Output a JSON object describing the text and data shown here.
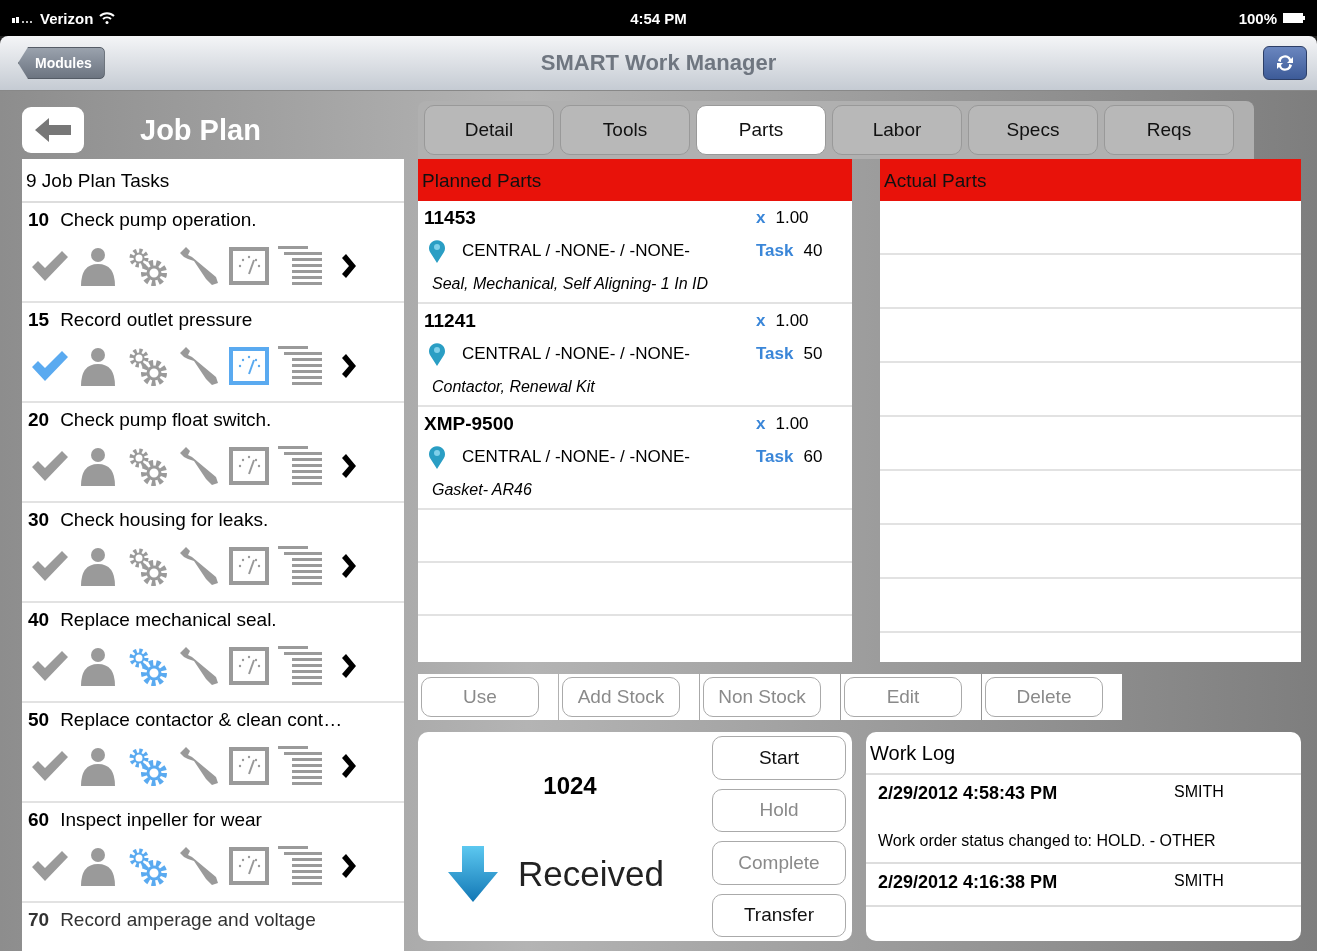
{
  "status_bar": {
    "carrier": "Verizon",
    "time": "4:54 PM",
    "battery": "100%"
  },
  "nav_bar": {
    "back_button": "Modules",
    "title": "SMART Work Manager"
  },
  "job_plan": {
    "title": "Job Plan",
    "count_label": "9 Job Plan Tasks",
    "tasks": [
      {
        "number": "10",
        "text": "Check pump operation.",
        "completed": false,
        "labor": false,
        "parts": false,
        "tools": false,
        "meters": false,
        "notes": false
      },
      {
        "number": "15",
        "text": "Record outlet pressure",
        "completed": true,
        "labor": false,
        "parts": false,
        "tools": false,
        "meters": true,
        "notes": false
      },
      {
        "number": "20",
        "text": "Check pump float switch.",
        "completed": false,
        "labor": false,
        "parts": false,
        "tools": false,
        "meters": false,
        "notes": false
      },
      {
        "number": "30",
        "text": "Check housing for leaks.",
        "completed": false,
        "labor": false,
        "parts": false,
        "tools": false,
        "meters": false,
        "notes": false
      },
      {
        "number": "40",
        "text": "Replace mechanical seal.",
        "completed": false,
        "labor": false,
        "parts": true,
        "tools": false,
        "meters": false,
        "notes": false
      },
      {
        "number": "50",
        "text": "Replace contactor & clean cont…",
        "completed": false,
        "labor": false,
        "parts": true,
        "tools": false,
        "meters": false,
        "notes": false
      },
      {
        "number": "60",
        "text": "Inspect inpeller for wear",
        "completed": false,
        "labor": false,
        "parts": true,
        "tools": false,
        "meters": false,
        "notes": false
      },
      {
        "number": "70",
        "text": "Record amperage and voltage",
        "partial": true
      }
    ]
  },
  "tabs": [
    {
      "label": "Detail",
      "selected": false
    },
    {
      "label": "Tools",
      "selected": false
    },
    {
      "label": "Parts",
      "selected": true
    },
    {
      "label": "Labor",
      "selected": false
    },
    {
      "label": "Specs",
      "selected": false
    },
    {
      "label": "Reqs",
      "selected": false
    }
  ],
  "planned_parts": {
    "title": "Planned Parts",
    "rows": [
      {
        "part": "11453",
        "qty_label": "x",
        "qty": "1.00",
        "location": "CENTRAL / -NONE- / -NONE-",
        "task_label": "Task",
        "task": "40",
        "description": "Seal, Mechanical, Self Aligning- 1 In ID"
      },
      {
        "part": "11241",
        "qty_label": "x",
        "qty": "1.00",
        "location": "CENTRAL / -NONE- / -NONE-",
        "task_label": "Task",
        "task": "50",
        "description": "Contactor, Renewal Kit"
      },
      {
        "part": "XMP-9500",
        "qty_label": "x",
        "qty": "1.00",
        "location": "CENTRAL / -NONE- / -NONE-",
        "task_label": "Task",
        "task": "60",
        "description": "Gasket- AR46"
      }
    ]
  },
  "actual_parts": {
    "title": "Actual Parts"
  },
  "part_actions": [
    {
      "label": "Use",
      "disabled": true
    },
    {
      "label": "Add Stock",
      "disabled": true
    },
    {
      "label": "Non Stock",
      "disabled": true
    },
    {
      "label": "Edit",
      "disabled": true
    },
    {
      "label": "Delete",
      "disabled": true
    }
  ],
  "work_order": {
    "number": "1024",
    "status": "Received",
    "actions": [
      {
        "label": "Start",
        "disabled": false
      },
      {
        "label": "Hold",
        "disabled": true
      },
      {
        "label": "Complete",
        "disabled": true
      },
      {
        "label": "Transfer",
        "disabled": false
      }
    ]
  },
  "work_log": {
    "title": "Work Log",
    "entries": [
      {
        "timestamp": "2/29/2012 4:58:43 PM",
        "user": "SMITH",
        "message": "Work order status changed to: HOLD. - OTHER"
      },
      {
        "timestamp": "2/29/2012 4:16:38 PM",
        "user": "SMITH"
      }
    ]
  }
}
